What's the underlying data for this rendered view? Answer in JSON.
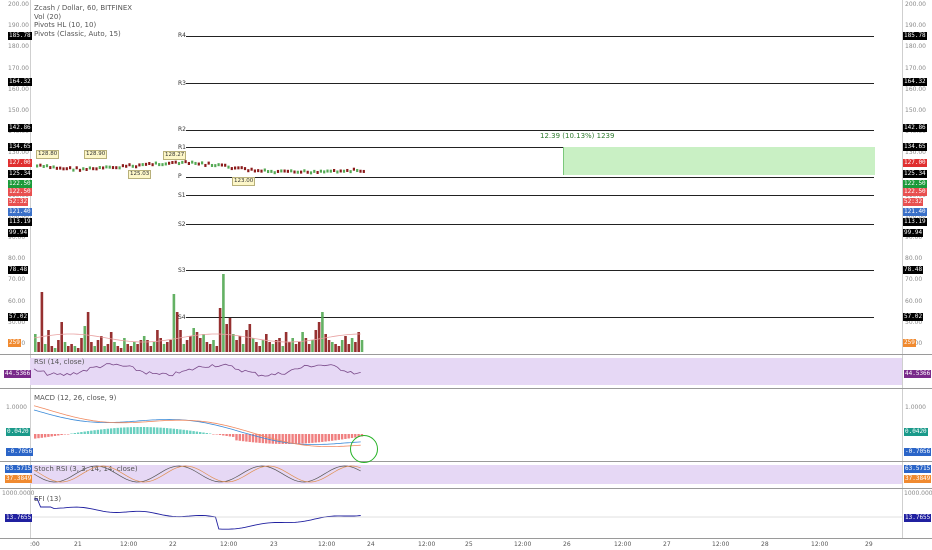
{
  "main_legend": {
    "title": "Zcash / Dollar, 60, BITFINEX",
    "ind1": "Vol (20)",
    "ind2": "Pivots HL (10, 10)",
    "ind3": "Pivots (Classic, Auto, 15)"
  },
  "price_axis": {
    "ticks": [
      "200.00",
      "190.00",
      "180.00",
      "170.00",
      "160.00",
      "150.00",
      "140.00",
      "130.00",
      "120.00",
      "110.00",
      "100.00",
      "90.00",
      "80.00",
      "70.00",
      "60.00",
      "50.00",
      "40.00"
    ],
    "badges": [
      {
        "text": "185.78",
        "color": "#000000"
      },
      {
        "text": "164.32",
        "color": "#000000"
      },
      {
        "text": "142.86",
        "color": "#000000"
      },
      {
        "text": "134.65",
        "color": "#000000"
      },
      {
        "text": "127.00",
        "color": "#e03030"
      },
      {
        "text": "125.34",
        "color": "#000000"
      },
      {
        "text": "122.50",
        "color": "#1a9a3a"
      },
      {
        "text": "122.50",
        "color": "#e85050"
      },
      {
        "text": "52:32",
        "color": "#e85050"
      },
      {
        "text": "121.40",
        "color": "#3a70c8"
      },
      {
        "text": "113.19",
        "color": "#000000"
      },
      {
        "text": "99.94",
        "color": "#000000"
      },
      {
        "text": "78.48",
        "color": "#000000"
      },
      {
        "text": "57.02",
        "color": "#000000"
      },
      {
        "text": "259",
        "color": "#f08a30"
      }
    ]
  },
  "pivots": {
    "labels": [
      "R4",
      "R3",
      "R2",
      "R1",
      "P",
      "S1",
      "S2",
      "S3",
      "S4"
    ]
  },
  "hl_annotations": [
    "128.80",
    "128.90",
    "125.03",
    "128.27",
    "123.00"
  ],
  "measure": {
    "text": "12.39 (10.13%) 1239"
  },
  "rsi": {
    "legend": "RSI (14, close)",
    "value": "44.5366"
  },
  "macd": {
    "legend": "MACD (12, 26, close, 9)",
    "ticks": [
      "1.0000",
      "-1.0000"
    ],
    "values": [
      "0.0420",
      "-0.7056"
    ]
  },
  "stoch": {
    "legend": "Stoch RSI (3, 3, 14, 14, close)",
    "values": [
      "63.5715",
      "37.3849"
    ]
  },
  "efi": {
    "legend": "EFI (13)",
    "tick": "1000.0000",
    "value": "13.7655"
  },
  "x_axis": {
    "labels": [
      ":00",
      "21",
      "12:00",
      "22",
      "12:00",
      "23",
      "12:00",
      "24",
      "12:00",
      "25",
      "12:00",
      "26",
      "12:00",
      "27",
      "12:00",
      "28",
      "12:00",
      "29"
    ]
  },
  "colors": {
    "up": "#53a853",
    "down": "#8b1a1a",
    "rsi_bg": "#e6d8f5",
    "measure": "#c9f0c4"
  }
}
